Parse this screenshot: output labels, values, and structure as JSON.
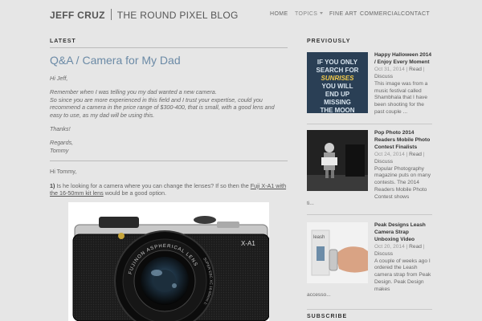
{
  "header": {
    "author": "JEFF CRUZ",
    "blog_title": "THE ROUND PIXEL BLOG",
    "nav": [
      "HOME",
      "TOPICS",
      "FINE ART",
      "COMMERCIAL",
      "CONTACT"
    ]
  },
  "main": {
    "section_title": "LATEST",
    "post_title": "Q&A / Camera for My Dad",
    "letter": {
      "greeting": "Hi Jeff,",
      "line1": "Remember when I was telling you my dad wanted a new camera.",
      "line2": "So since you are more experienced in this field and I trust your expertise, could you recommend a camera in the price range of $300-400, that is small, with a good lens and easy to use, as my dad will be using this.",
      "thanks": "Thanks!",
      "regards": "Regards,",
      "signature": "Tommy"
    },
    "answer": {
      "greeting": "Hi Tommy,",
      "num": "1)",
      "text_before": " Is he looking for a camera where you can change the lenses? If so then the ",
      "link": "Fuji X-A1 with the 16-50mm kit lens",
      "text_after": " would be a good option."
    },
    "photo": {
      "model": "X-A1",
      "lens_ring": "FUJINON ASPHERICAL LENS",
      "lens_ring2": "SUPER EBC XC 16-50mm 1:3.5-5.6 OIS"
    }
  },
  "sidebar": {
    "section_title": "PREVIOUSLY",
    "read_label": "Read",
    "items": [
      {
        "title": "Happy Halloween 2014 / Enjoy Every Moment",
        "date": "Oct 31, 2014",
        "category": "Discuss",
        "excerpt": "This image was from a music festival called Shambhala that I have been shooting for the past couple ...",
        "thumb_text": [
          "IF YOU ONLY",
          "SEARCH FOR",
          "SUNRISES",
          "YOU WILL",
          "END UP",
          "MISSING",
          "THE MOON"
        ]
      },
      {
        "title": "Pop Photo 2014 Readers Mobile Photo Contest Finalists",
        "date": "Oct 24, 2014",
        "category": "Discuss",
        "excerpt": "Popular Photography magazine puts on many contests.  The 2014 Readers Mobile Photo Contest shows",
        "overflow": "ti..."
      },
      {
        "title": "Peak Designs Leash Camera Strap Unboxing Video",
        "date": "Oct 20, 2014",
        "category": "Discuss",
        "excerpt": "A couple of weeks ago I ordered the Leash camera strap from Peak Design.  Peak Design makes",
        "overflow": "accesso...",
        "thumb_label": "leash"
      }
    ],
    "subscribe_title": "SUBSCRIBE"
  },
  "colors": {
    "background": "#e6e6e6",
    "title_blue": "#6b8aa6"
  }
}
